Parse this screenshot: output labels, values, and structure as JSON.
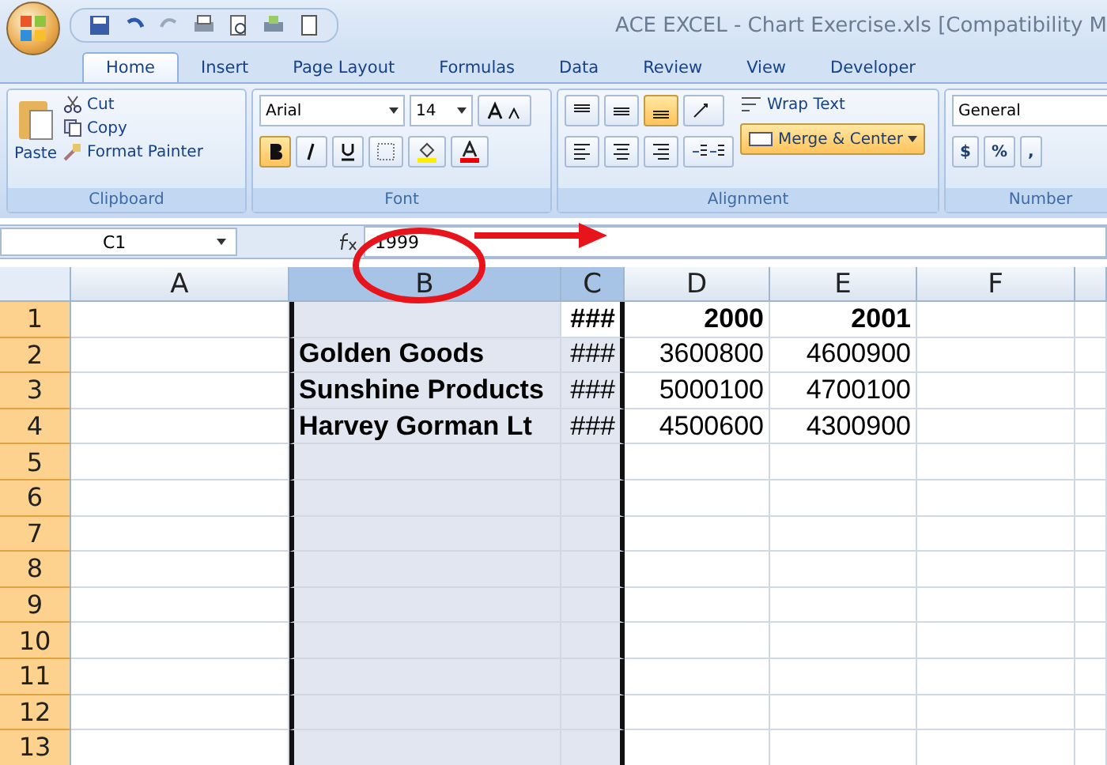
{
  "window": {
    "title": "ACE EXCEL - Chart Exercise.xls  [Compatibility M"
  },
  "tabs": [
    {
      "label": "Home",
      "selected": true
    },
    {
      "label": "Insert",
      "selected": false
    },
    {
      "label": "Page Layout",
      "selected": false
    },
    {
      "label": "Formulas",
      "selected": false
    },
    {
      "label": "Data",
      "selected": false
    },
    {
      "label": "Review",
      "selected": false
    },
    {
      "label": "View",
      "selected": false
    },
    {
      "label": "Developer",
      "selected": false
    }
  ],
  "clipboard": {
    "label": "Clipboard",
    "paste": "Paste",
    "cut": "Cut",
    "copy": "Copy",
    "format_painter": "Format Painter"
  },
  "font": {
    "label": "Font",
    "name": "Arial",
    "size": "14",
    "bold": true,
    "italic": false,
    "underline": false
  },
  "alignment": {
    "label": "Alignment",
    "vertical": [
      {
        "kind": "top",
        "selected": false
      },
      {
        "kind": "middle",
        "selected": false
      },
      {
        "kind": "bottom",
        "selected": true
      }
    ],
    "wrap_text": "Wrap Text",
    "merge_center": "Merge & Center",
    "merge_on": true
  },
  "number": {
    "label": "Number",
    "format": "General",
    "currency": "$",
    "percent": "%",
    "comma": ","
  },
  "formula_bar": {
    "name_box": "C1",
    "value": "1999"
  },
  "sheet": {
    "columns": [
      {
        "label": "A",
        "selected": false
      },
      {
        "label": "B",
        "selected": true
      },
      {
        "label": "C",
        "selected": true
      },
      {
        "label": "D",
        "selected": false
      },
      {
        "label": "E",
        "selected": false
      },
      {
        "label": "F",
        "selected": false
      }
    ],
    "rows": [
      {
        "label": "1",
        "selected": true,
        "cells": [
          {
            "active": false
          },
          {
            "active": false
          },
          {
            "text": "###",
            "bold": true,
            "active": true
          },
          {
            "text": "2000",
            "bold": true,
            "active": false
          },
          {
            "text": "2001",
            "bold": true,
            "active": false
          },
          {
            "active": false
          }
        ]
      },
      {
        "label": "2",
        "selected": true,
        "cells": [
          {
            "active": false
          },
          {
            "text": "Golden Goods",
            "bold": true,
            "active": false
          },
          {
            "text": "###",
            "bold": false,
            "active": false
          },
          {
            "text": "3600800",
            "bold": false,
            "active": false
          },
          {
            "text": "4600900",
            "bold": false,
            "active": false
          },
          {
            "active": false
          }
        ]
      },
      {
        "label": "3",
        "selected": true,
        "cells": [
          {
            "active": false
          },
          {
            "text": "Sunshine Products",
            "bold": true,
            "active": false
          },
          {
            "text": "###",
            "bold": false,
            "active": false
          },
          {
            "text": "5000100",
            "bold": false,
            "active": false
          },
          {
            "text": "4700100",
            "bold": false,
            "active": false
          },
          {
            "active": false
          }
        ]
      },
      {
        "label": "4",
        "selected": true,
        "cells": [
          {
            "active": false
          },
          {
            "text": "Harvey Gorman Lt",
            "bold": true,
            "active": false
          },
          {
            "text": "###",
            "bold": false,
            "active": false
          },
          {
            "text": "4500600",
            "bold": false,
            "active": false
          },
          {
            "text": "4300900",
            "bold": false,
            "active": false
          },
          {
            "active": false
          }
        ]
      },
      {
        "label": "5",
        "selected": true
      },
      {
        "label": "6",
        "selected": true
      },
      {
        "label": "7",
        "selected": true
      },
      {
        "label": "8",
        "selected": true
      },
      {
        "label": "9",
        "selected": true
      },
      {
        "label": "10",
        "selected": true
      },
      {
        "label": "11",
        "selected": true
      },
      {
        "label": "12",
        "selected": true
      },
      {
        "label": "13",
        "selected": true
      }
    ]
  }
}
